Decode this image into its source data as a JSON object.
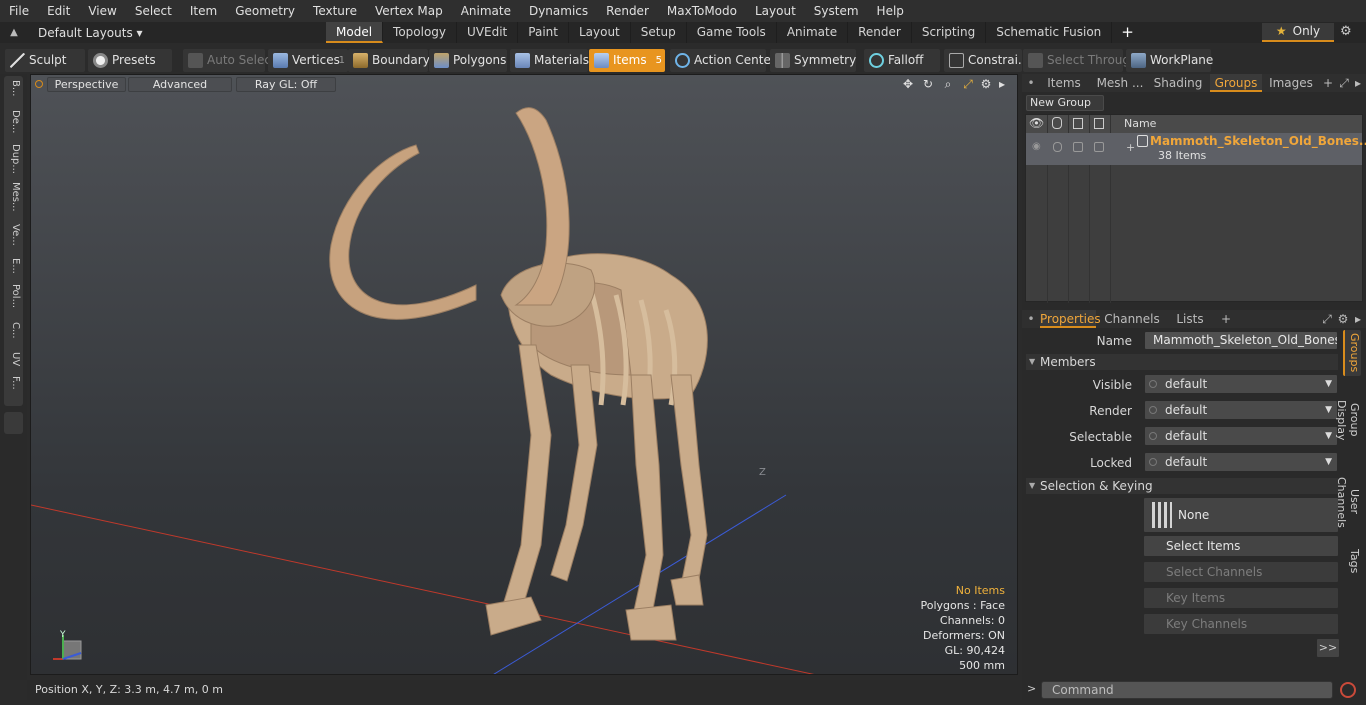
{
  "menu": [
    "File",
    "Edit",
    "View",
    "Select",
    "Item",
    "Geometry",
    "Texture",
    "Vertex Map",
    "Animate",
    "Dynamics",
    "Render",
    "MaxToModo",
    "Layout",
    "System",
    "Help"
  ],
  "layouts": {
    "label": "Default Layouts ▾"
  },
  "tabs": [
    {
      "label": "Model",
      "active": true
    },
    {
      "label": "Topology"
    },
    {
      "label": "UVEdit"
    },
    {
      "label": "Paint"
    },
    {
      "label": "Layout"
    },
    {
      "label": "Setup"
    },
    {
      "label": "Game Tools"
    },
    {
      "label": "Animate"
    },
    {
      "label": "Render"
    },
    {
      "label": "Scripting"
    },
    {
      "label": "Schematic Fusion"
    }
  ],
  "tabs_plus": "+",
  "only": {
    "label": "Only",
    "star": "★"
  },
  "toolbar": {
    "sculpt": "Sculpt",
    "presets": "Presets",
    "auto_select": "Auto Select",
    "vertices": "Vertices",
    "vertices_count": "1",
    "boundary": "Boundary",
    "polygons": "Polygons",
    "materials": "Materials",
    "items": "Items",
    "items_count": "5",
    "action_center": "Action Center",
    "symmetry": "Symmetry",
    "falloff": "Falloff",
    "constrain": "Constrai...",
    "select_through": "Select Through",
    "workplane": "WorkPlane"
  },
  "left_tools": [
    "B...",
    "De...",
    "Dup...",
    "Mes...",
    "Ve...",
    "E...",
    "Pol...",
    "C...",
    "UV",
    "F..."
  ],
  "viewport": {
    "perspective": "Perspective",
    "advanced": "Advanced",
    "raygl": "Ray GL: Off",
    "info": {
      "no_items": "No Items",
      "polygons": "Polygons : Face",
      "channels": "Channels: 0",
      "deformers": "Deformers: ON",
      "gl": "GL: 90,424",
      "scale": "500 mm"
    },
    "axis_label_y": "Y",
    "axis_label_z": "Z"
  },
  "status": {
    "position": "Position X, Y, Z:   3.3 m, 4.7 m, 0 m"
  },
  "groups_panel": {
    "tabs": [
      "Items",
      "Mesh ...",
      "Shading",
      "Groups",
      "Images"
    ],
    "active_tab": "Groups",
    "new_group": "New Group",
    "column_name": "Name",
    "group": {
      "name": "Mammoth_Skeleton_Old_Bones...",
      "count": "38 Items",
      "expander": "+"
    }
  },
  "properties": {
    "tabs": [
      "Properties",
      "Channels",
      "Lists"
    ],
    "name_label": "Name",
    "name_value": "Mammoth_Skeleton_Old_Bones_Standing",
    "members_section": "Members",
    "visible_label": "Visible",
    "visible_value": "default",
    "render_label": "Render",
    "render_value": "default",
    "selectable_label": "Selectable",
    "selectable_value": "default",
    "locked_label": "Locked",
    "locked_value": "default",
    "selection_section": "Selection & Keying",
    "none_button": "None",
    "select_items": "Select Items",
    "select_channels": "Select Channels",
    "key_items": "Key Items",
    "key_channels": "Key Channels",
    "more": ">>"
  },
  "side_tabs": [
    "Groups",
    "Group Display",
    "User Channels",
    "Tags"
  ],
  "command": {
    "prompt": ">",
    "placeholder": "Command"
  }
}
